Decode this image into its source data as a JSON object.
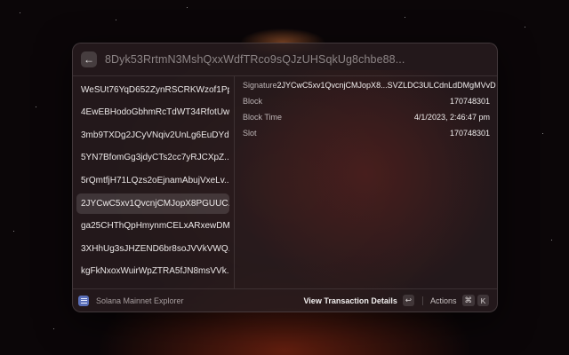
{
  "header": {
    "back_icon": "arrow-left-icon",
    "search_value": "8Dyk53RrtmN3MshQxxWdfTRco9sQJzUHSqkUg8chbe88..."
  },
  "list": {
    "items": [
      {
        "label": "WeSUt76YqD652ZynRSCRKWzof1Pp..."
      },
      {
        "label": "4EwEBHodoGbhmRcTdWT34RfotUw..."
      },
      {
        "label": "3mb9TXDg2JCyVNqiv2UnLg6EuDYd..."
      },
      {
        "label": "5YN7BfomGg3jdyCTs2cc7yRJCXpZ..."
      },
      {
        "label": "5rQmtfjH71LQzs2oEjnamAbujVxeLv..."
      },
      {
        "label": "2JYCwC5xv1QvcnjCMJopX8PGUUC..."
      },
      {
        "label": "ga25CHThQpHmynmCELxARxewDM..."
      },
      {
        "label": "3XHhUg3sJHZEND6br8soJVVkVWQ..."
      },
      {
        "label": "kgFkNxoxWuirWpZTRA5fJN8msVVk..."
      }
    ],
    "selected_index": 5
  },
  "details": {
    "rows": [
      {
        "key": "Signature",
        "value": "2JYCwC5xv1QvcnjCMJopX8...SVZLDC3ULCdnLdDMgMVvD"
      },
      {
        "key": "Block",
        "value": "170748301"
      },
      {
        "key": "Block Time",
        "value": "4/1/2023, 2:46:47 pm"
      },
      {
        "key": "Slot",
        "value": "170748301"
      }
    ]
  },
  "footer": {
    "app_icon": "list-icon",
    "app_title": "Solana Mainnet Explorer",
    "primary_action": "View Transaction Details",
    "primary_shortcut": "↩",
    "actions_label": "Actions",
    "actions_shortcut_mod": "⌘",
    "actions_shortcut_key": "K"
  }
}
